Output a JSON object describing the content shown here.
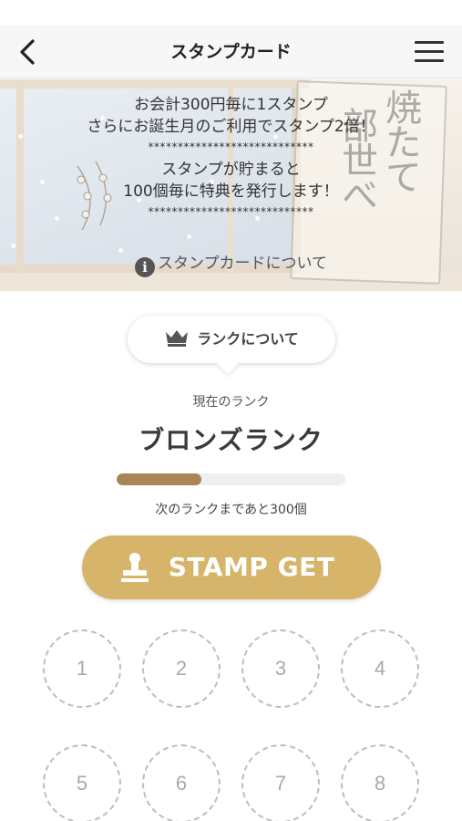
{
  "header": {
    "title": "スタンプカード",
    "back_icon": "chevron-left-icon",
    "menu_icon": "hamburger-menu-icon"
  },
  "banner": {
    "line1": "お会計300円毎に1スタンプ",
    "line2": "さらにお誕生月のご利用でスタンプ2倍！",
    "stars": "****************************",
    "line3": "スタンプが貯まると",
    "line4": "100個毎に特典を発行します！",
    "about_link": "スタンプカードについて",
    "sign_text_1": "焼たて",
    "sign_text_2": "部世べ"
  },
  "rank": {
    "about_button": "ランクについて",
    "caption": "現在のランク",
    "name": "ブロンズランク",
    "progress_fraction": 0.37,
    "next_rank_text": "次のランクまであと300個"
  },
  "stamp_button": {
    "label": "STAMP GET",
    "color": "#d6b46a"
  },
  "stamp_slots": [
    "1",
    "2",
    "3",
    "4",
    "5",
    "6",
    "7",
    "8"
  ],
  "colors": {
    "accent_gold": "#d6b46a",
    "progress_bronze": "#a88456",
    "progress_track": "#eeeff3"
  }
}
